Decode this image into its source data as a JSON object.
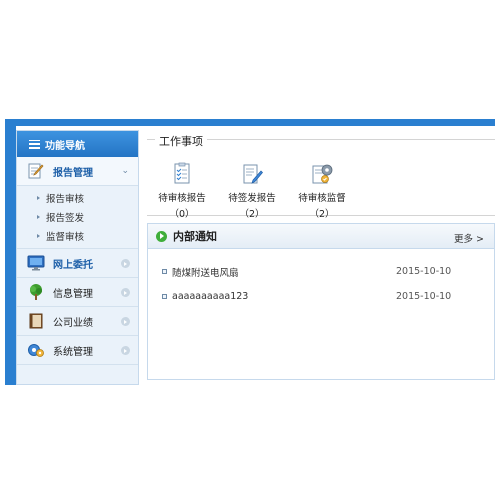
{
  "sidebar": {
    "title": "功能导航",
    "menu": [
      {
        "label": "报告管理",
        "active": true
      },
      {
        "label": "网上委托"
      },
      {
        "label": "信息管理"
      },
      {
        "label": "公司业绩"
      },
      {
        "label": "系统管理"
      }
    ],
    "submenu": [
      "报告审核",
      "报告签发",
      "监督审核"
    ]
  },
  "work": {
    "title": "工作事项",
    "items": [
      {
        "label": "待审核报告",
        "count": "（0）"
      },
      {
        "label": "待签发报告",
        "count": "（2）"
      },
      {
        "label": "待审核监督",
        "count": "（2）"
      }
    ]
  },
  "notices": {
    "title": "内部通知",
    "more": "更多 >",
    "items": [
      {
        "title": "随煤附送电风扇",
        "date": "2015-10-10"
      },
      {
        "title": "aaaaaaaaaa123",
        "date": "2015-10-10"
      }
    ]
  },
  "colors": {
    "frame": "#2a7fd0",
    "sidebar_bg": "#eaf2fa",
    "accent_green": "#3fae3a",
    "active_text": "#1d5fa8"
  }
}
